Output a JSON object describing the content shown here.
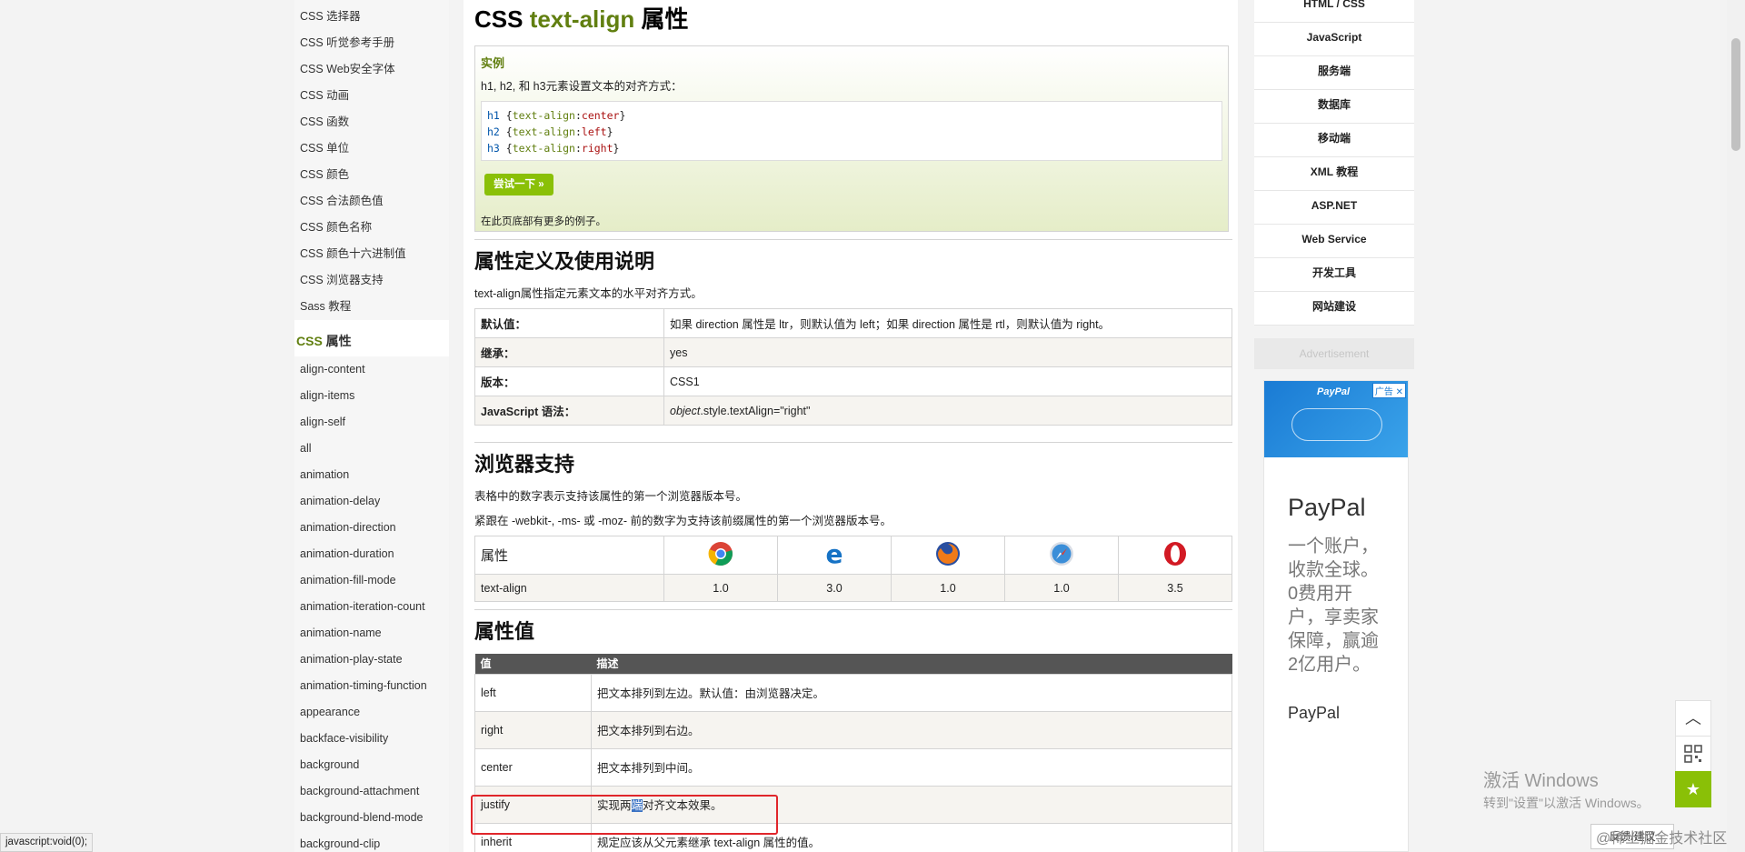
{
  "left_nav": {
    "items_top": [
      "CSS 选择器",
      "CSS 听觉参考手册",
      "CSS Web安全字体",
      "CSS 动画",
      "CSS 函数",
      "CSS 单位",
      "CSS 颜色",
      "CSS 合法颜色值",
      "CSS 颜色名称",
      "CSS 颜色十六进制值",
      "CSS 浏览器支持",
      "Sass 教程"
    ],
    "section_prefix": "CSS",
    "section_suffix": " 属性",
    "items_props": [
      "align-content",
      "align-items",
      "align-self",
      "all",
      "animation",
      "animation-delay",
      "animation-direction",
      "animation-duration",
      "animation-fill-mode",
      "animation-iteration-count",
      "animation-name",
      "animation-play-state",
      "animation-timing-function",
      "appearance",
      "backface-visibility",
      "background",
      "background-attachment",
      "background-blend-mode",
      "background-clip"
    ]
  },
  "main": {
    "title_prefix": "CSS ",
    "title_hl": "text-align",
    "title_suffix": " 属性",
    "example": {
      "heading": "实例",
      "desc": "h1, h2, 和 h3元素设置文本的对齐方式：",
      "code": [
        {
          "sel": "h1",
          "prop": "text-align",
          "val": "center"
        },
        {
          "sel": "h2",
          "prop": "text-align",
          "val": "left"
        },
        {
          "sel": "h3",
          "prop": "text-align",
          "val": "right"
        }
      ],
      "try_button": "尝试一下 »",
      "more": "在此页底部有更多的例子。"
    },
    "definition": {
      "heading": "属性定义及使用说明",
      "desc": "text-align属性指定元素文本的水平对齐方式。",
      "rows": [
        {
          "k": "默认值：",
          "v": "如果 direction 属性是 ltr，则默认值为 left；如果 direction 属性是 rtl，则默认值为 right。"
        },
        {
          "k": "继承：",
          "v": "yes"
        },
        {
          "k": "版本：",
          "v": "CSS1"
        },
        {
          "k": "JavaScript 语法：",
          "v_em": "object",
          "v": ".style.textAlign=\"right\""
        }
      ]
    },
    "browser": {
      "heading": "浏览器支持",
      "desc1": "表格中的数字表示支持该属性的第一个浏览器版本号。",
      "desc2": "紧跟在 -webkit-, -ms- 或 -moz- 前的数字为支持该前缀属性的第一个浏览器版本号。",
      "col_label": "属性",
      "browsers": [
        "chrome-icon",
        "edge-icon",
        "firefox-icon",
        "safari-icon",
        "opera-icon"
      ],
      "row_label": "text-align",
      "versions": [
        "1.0",
        "3.0",
        "1.0",
        "1.0",
        "3.5"
      ]
    },
    "values": {
      "heading": "属性值",
      "col_value": "值",
      "col_desc": "描述",
      "rows": [
        {
          "v": "left",
          "d": "把文本排列到左边。默认值：由浏览器决定。"
        },
        {
          "v": "right",
          "d": "把文本排列到右边。"
        },
        {
          "v": "center",
          "d": "把文本排列到中间。"
        },
        {
          "v": "justify",
          "d_pre": "实现两",
          "d_sel": "端",
          "d_post": "对齐文本效果。"
        },
        {
          "v": "inherit",
          "d": "规定应该从父元素继承 text-align 属性的值。"
        }
      ]
    }
  },
  "right_nav": {
    "items": [
      "HTML / CSS",
      "JavaScript",
      "服务端",
      "数据库",
      "移动端",
      "XML 教程",
      "ASP.NET",
      "Web Service",
      "开发工具",
      "网站建设"
    ],
    "ad_title": "Advertisement"
  },
  "ad": {
    "logo": "PayPal",
    "tag": "广告",
    "brand": "PayPal",
    "slogan": "一个账户，收款全球。0费用开户，享卖家保障，赢逾2亿用户。",
    "brand2": "PayPal"
  },
  "watermark": {
    "line1": "激活 Windows",
    "line2": "转到\"设置\"以激活 Windows。"
  },
  "feedback": "反馈/建议",
  "community": "@稀土掘金技术社区",
  "status_bar": "javascript:void(0);",
  "accent_color": "#8AC007"
}
